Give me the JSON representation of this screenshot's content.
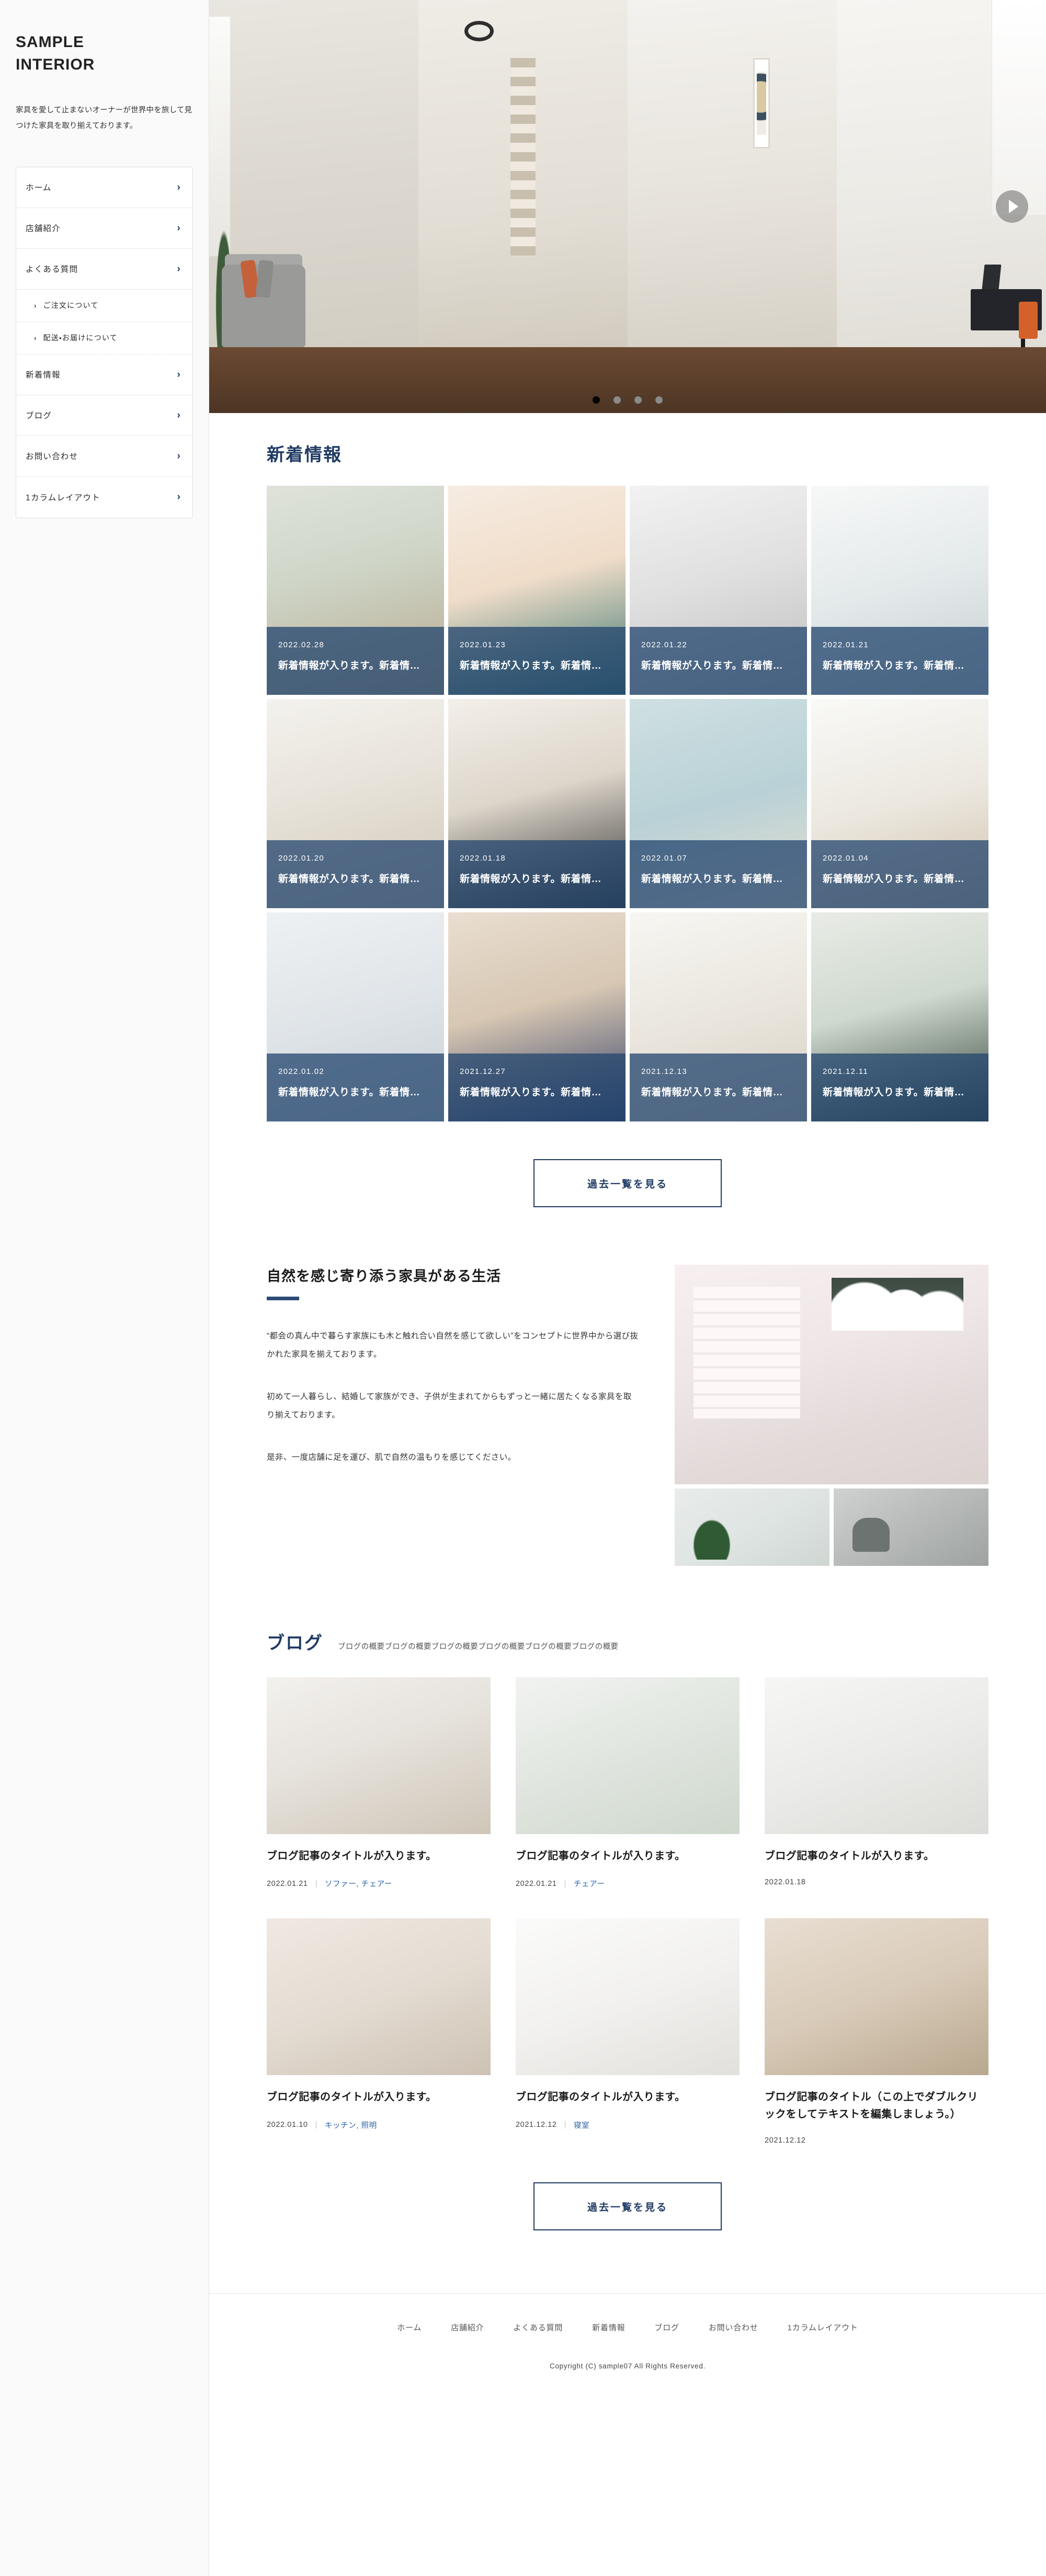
{
  "sidebar": {
    "brand_line1": "SAMPLE",
    "brand_line2": "INTERIOR",
    "description": "家具を愛して止まないオーナーが世界中を旅して見つけた家具を取り揃えております。",
    "nav": [
      {
        "label": "ホーム",
        "type": "item",
        "icon": "chevron-right-icon"
      },
      {
        "label": "店舗紹介",
        "type": "item",
        "icon": "chevron-right-icon"
      },
      {
        "label": "よくある質問",
        "type": "item",
        "icon": "chevron-right-icon"
      },
      {
        "label": "ご注文について",
        "type": "sub",
        "icon": "chevron-right-small-icon"
      },
      {
        "label": "配送・お届けについて",
        "type": "sub",
        "icon": "chevron-right-small-icon"
      },
      {
        "label": "新着情報",
        "type": "item",
        "icon": "chevron-right-icon"
      },
      {
        "label": "ブログ",
        "type": "item",
        "icon": "chevron-right-icon"
      },
      {
        "label": "お問い合わせ",
        "type": "item",
        "icon": "chevron-right-icon"
      },
      {
        "label": "1カラムレイアウト",
        "type": "item",
        "icon": "chevron-right-icon"
      }
    ]
  },
  "hero": {
    "next_icon": "next-arrow-icon",
    "dots": 4,
    "active_dot": 0
  },
  "news": {
    "title": "新着情報",
    "items": [
      {
        "date": "2022.02.28",
        "text": "新着情報が入ります。新着情…"
      },
      {
        "date": "2022.01.23",
        "text": "新着情報が入ります。新着情…"
      },
      {
        "date": "2022.01.22",
        "text": "新着情報が入ります。新着情…"
      },
      {
        "date": "2022.01.21",
        "text": "新着情報が入ります。新着情…"
      },
      {
        "date": "2022.01.20",
        "text": "新着情報が入ります。新着情…"
      },
      {
        "date": "2022.01.18",
        "text": "新着情報が入ります。新着情…"
      },
      {
        "date": "2022.01.07",
        "text": "新着情報が入ります。新着情…"
      },
      {
        "date": "2022.01.04",
        "text": "新着情報が入ります。新着情…"
      },
      {
        "date": "2022.01.02",
        "text": "新着情報が入ります。新着情…"
      },
      {
        "date": "2021.12.27",
        "text": "新着情報が入ります。新着情…"
      },
      {
        "date": "2021.12.13",
        "text": "新着情報が入ります。新着情…"
      },
      {
        "date": "2021.12.11",
        "text": "新着情報が入ります。新着情…"
      }
    ],
    "more_button": "過去一覧を見る"
  },
  "about": {
    "title": "自然を感じ寄り添う家具がある生活",
    "paragraph1": "“都会の真ん中で暮らす家族にも木と触れ合い自然を感じて欲しい”をコンセプトに世界中から選び抜かれた家具を揃えております。",
    "paragraph2": "初めて一人暮らし、結婚して家族ができ、子供が生まれてからもずっと一緒に居たくなる家具を取り揃えております。",
    "paragraph3": "是非、一度店舗に足を運び、肌で自然の温もりを感じてください。"
  },
  "blog": {
    "title": "ブログ",
    "subtitle": "ブログの概要ブログの概要ブログの概要ブログの概要ブログの概要ブログの概要",
    "posts": [
      {
        "title": "ブログ記事のタイトルが入ります。",
        "date": "2022.01.21",
        "category": "ソファー, チェアー"
      },
      {
        "title": "ブログ記事のタイトルが入ります。",
        "date": "2022.01.21",
        "category": "チェアー"
      },
      {
        "title": "ブログ記事のタイトルが入ります。",
        "date": "2022.01.18",
        "category": ""
      },
      {
        "title": "ブログ記事のタイトルが入ります。",
        "date": "2022.01.10",
        "category": "キッチン, 照明"
      },
      {
        "title": "ブログ記事のタイトルが入ります。",
        "date": "2021.12.12",
        "category": "寝室"
      },
      {
        "title": "ブログ記事のタイトル（この上でダブルクリックをしてテキストを編集しましょう。）",
        "date": "2021.12.12",
        "category": ""
      }
    ],
    "more_button": "過去一覧を見る"
  },
  "footer": {
    "nav": [
      "ホーム",
      "店舗紹介",
      "よくある質問",
      "新着情報",
      "ブログ",
      "お問い合わせ",
      "1カラムレイアウト"
    ],
    "copyright": "Copyright (C) sample07 All Rights Reserved."
  },
  "colors": {
    "accent": "#1f3a63",
    "overlay": "#23466e",
    "link": "#2c63a8"
  }
}
